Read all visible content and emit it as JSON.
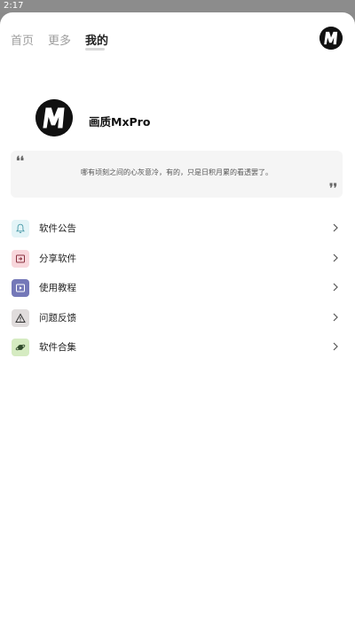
{
  "status_bar": {
    "time": "2:17"
  },
  "nav": {
    "tabs": [
      {
        "label": "首页",
        "active": false
      },
      {
        "label": "更多",
        "active": false
      },
      {
        "label": "我的",
        "active": true
      }
    ]
  },
  "profile": {
    "avatar_letter": "M",
    "name": "画质MxPro"
  },
  "quote": {
    "open_mark": "❛❛",
    "text": "哪有顷刻之间的心灰意冷，有的，只是日积月累的看透罢了。",
    "close_mark": "❜❜"
  },
  "menu": {
    "items": [
      {
        "label": "软件公告",
        "icon": "bell-icon",
        "icon_bg": "#e3f4f7",
        "icon_color": "#4a9aa8"
      },
      {
        "label": "分享软件",
        "icon": "share-icon",
        "icon_bg": "#f8d7dc",
        "icon_color": "#8a3240"
      },
      {
        "label": "使用教程",
        "icon": "play-icon",
        "icon_bg": "#7478b8",
        "icon_color": "#ffffff"
      },
      {
        "label": "问题反馈",
        "icon": "warning-icon",
        "icon_bg": "#e0dcdc",
        "icon_color": "#333333"
      },
      {
        "label": "软件合集",
        "icon": "planet-icon",
        "icon_bg": "#d5ebc1",
        "icon_color": "#2f4a2a"
      }
    ]
  },
  "colors": {
    "status_bar_bg": "#8c8c8c",
    "page_bg": "#ffffff",
    "tab_inactive": "#9e9e9e",
    "tab_active": "#222222",
    "quote_bg": "#f5f5f5"
  }
}
